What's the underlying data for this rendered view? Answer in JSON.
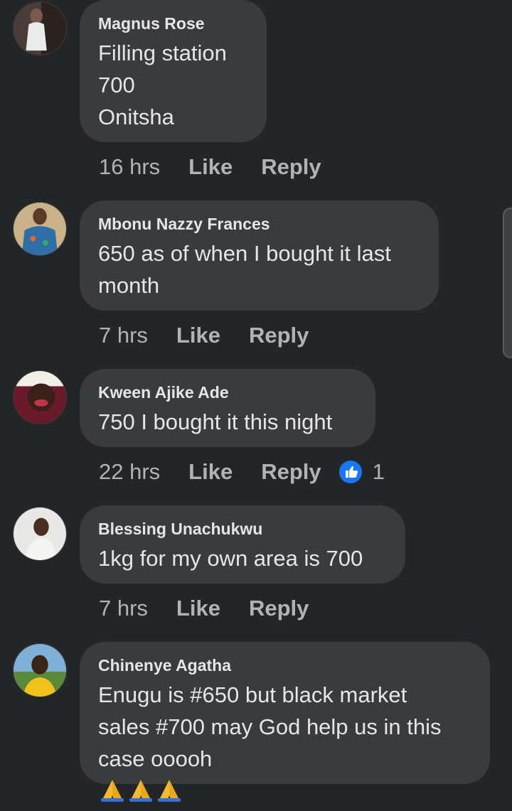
{
  "comments": [
    {
      "name": "Magnus Rose",
      "text": "Filling station\n700\nOnitsha",
      "time": "16 hrs",
      "like": "Like",
      "reply": "Reply"
    },
    {
      "name": "Mbonu Nazzy Frances",
      "text": "650 as of when I bought it last\nmonth",
      "time": "7 hrs",
      "like": "Like",
      "reply": "Reply"
    },
    {
      "name": "Kween Ajike Ade",
      "text": "750 I bought it this night",
      "time": "22 hrs",
      "like": "Like",
      "reply": "Reply",
      "reaction_count": "1"
    },
    {
      "name": "Blessing Unachukwu",
      "text": "1kg for my own area is 700",
      "time": "7 hrs",
      "like": "Like",
      "reply": "Reply"
    },
    {
      "name": "Chinenye Agatha",
      "text": "Enugu is #650 but black market\nsales #700 may God help us in this\ncase ooooh",
      "emoji": "folded-hands",
      "emoji_count": 3
    }
  ],
  "colors": {
    "background": "#242526",
    "bubble": "#3a3b3c",
    "text": "#e4e6eb",
    "secondary_text": "#b0b3b8",
    "like_reaction": "#1877f2"
  },
  "icons": [
    "like-reaction-icon",
    "folded-hands-emoji"
  ]
}
